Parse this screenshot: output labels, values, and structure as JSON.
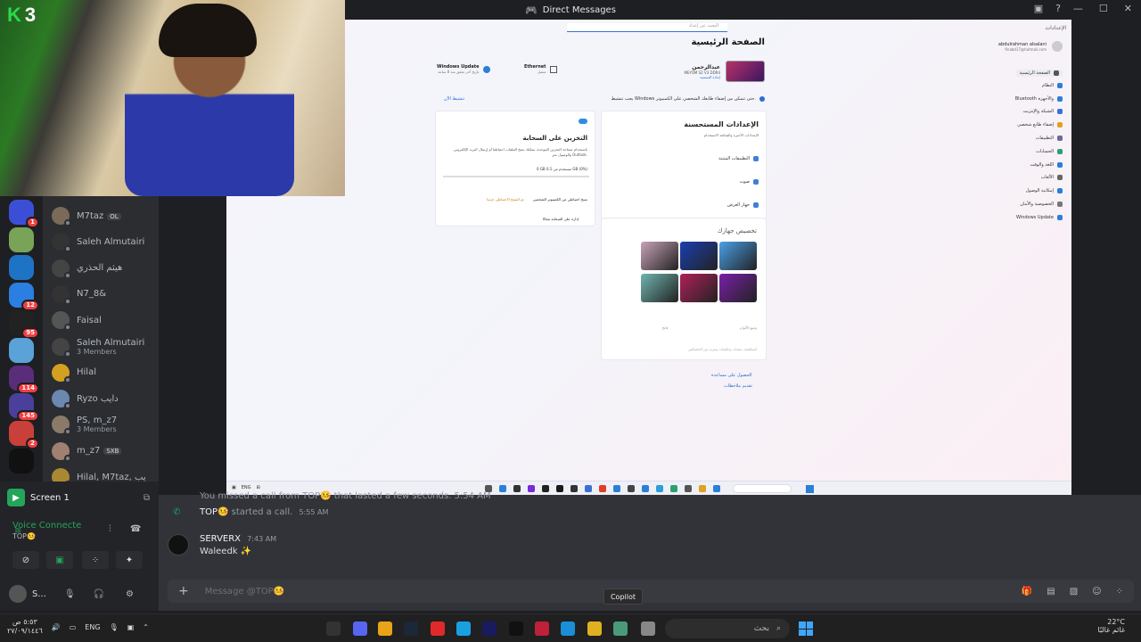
{
  "titlebar": {
    "title": "Direct Messages"
  },
  "webcam": {
    "logo_k": "K",
    "logo_num": "3"
  },
  "servers": [
    {
      "badge": "1",
      "color": "#3b4fd6"
    },
    {
      "badge": "",
      "color": "#7aa35a"
    },
    {
      "badge": "",
      "color": "#1e73c4"
    },
    {
      "badge": "12",
      "color": "#2a7fe0"
    },
    {
      "badge": "95",
      "color": "#222"
    },
    {
      "badge": "",
      "color": "#5aa2d8"
    },
    {
      "badge": "114",
      "color": "#5a2d7a"
    },
    {
      "badge": "145",
      "color": "#4b3f9c"
    },
    {
      "badge": "2",
      "color": "#c9403a"
    },
    {
      "badge": "",
      "color": "#111"
    }
  ],
  "dms": [
    {
      "name": "M7taz",
      "tag": "OL",
      "sub": ""
    },
    {
      "name": "Saleh Almutairi",
      "tag": "",
      "sub": ""
    },
    {
      "name": "هيثم الحذري",
      "tag": "",
      "sub": ""
    },
    {
      "name": "N7_8&",
      "tag": "",
      "sub": ""
    },
    {
      "name": "Faisal",
      "tag": "",
      "sub": ""
    },
    {
      "name": "Saleh Almutairi",
      "tag": "",
      "sub": "3 Members"
    },
    {
      "name": "Hilal",
      "tag": "",
      "sub": ""
    },
    {
      "name": "Ryzo دايب",
      "tag": "",
      "sub": ""
    },
    {
      "name": "PS, m_z7",
      "tag": "",
      "sub": "3 Members"
    },
    {
      "name": "m_z7",
      "tag": "SXB",
      "sub": ""
    },
    {
      "name": "Hilal, M7taz, يب",
      "tag": "",
      "sub": ""
    }
  ],
  "voice": {
    "screen_label": "Screen 1",
    "status": "Voice Connecte",
    "channel": "TOP🤒",
    "user_short": "S..."
  },
  "chat": {
    "partial_top": "You missed a call from TOP🤒 that lasted a few seconds. 5:54 AM",
    "call_started_user": "TOP🤒",
    "call_started_text": "started a call.",
    "call_time": "5:55 AM",
    "msg_author": "SERVERX",
    "msg_time": "7:43 AM",
    "msg_text": "Waleedk ✨",
    "composer_placeholder": "Message @TOP🤒"
  },
  "copilot_tip": "Copilot",
  "share": {
    "breadcrumb": "الإعدادات",
    "search_placeholder": "البحث عن إعداد",
    "page_title": "الصفحة الرئيسية",
    "user_name": "abdulrahman alsalani",
    "user_email": "finabd17@hotmail.com",
    "device_name": "عبدالرحمن",
    "device_spec": "MEYOM S2 V3 DDR4",
    "device_rename": "إعادة التسمية",
    "ethernet": "Ethernet",
    "ethernet_sub": "متصل",
    "winupdate": "Windows Update",
    "winupdate_sub": "تاريخ آخر تحقق منذ 8 ساعة",
    "activate_notice": "يجب تنشيط Windows حتى تتمكن من إضفاء طابعك الشخصي على الكمبيوتر.",
    "activate_link": "تنشيط الآن",
    "recommended_title": "الإعدادات المستحسنة",
    "recommended_sub": "الإعدادات الأخيرة والشائعة الاستخدام",
    "rec_items": [
      "التطبيقات المثبتة",
      "صوت",
      "جهاز العرض"
    ],
    "cloud_title": "التخزين على السحابة",
    "cloud_body": "باستخدام مساحة التخزين الموحدة، يمكنك نسخ الملفات احتياطيا أو إرسال البريد الإلكتروني والوصول عبر Outlook.",
    "cloud_usage": "0 GB مستخدم من 0.1 GB (0%)",
    "cloud_backup": "نسخ احتياطي من الكمبيوتر الشخصي",
    "cloud_backup_status": "تم النسخ الاحتياطي جزئيا",
    "cloud_manage": "إدارة على السحابة مجانًا",
    "personalize_title": "تخصيص جهازك",
    "color_mode": "وضع الألوان",
    "color_mode_val": "فاتح",
    "more_themes": "استكشف سمات وخلفيات ومزيد من الخصائص",
    "help": "الحصول على مساعدة",
    "feedback": "تقديم ملاحظات",
    "sidebar": [
      "الصفحة الرئيسية",
      "النظام",
      "Bluetooth والأجهزة",
      "الشبكة والإنترنت",
      "إضفاء طابع شخصي",
      "التطبيقات",
      "الحسابات",
      "اللغة والوقت",
      "الألعاب",
      "إمكانية الوصول",
      "الخصوصية والأمان",
      "Windows Update"
    ],
    "wallpapers": [
      "#c8a3b8",
      "#1a3fb0",
      "#4aa0e8",
      "#6fb5b0",
      "#b0205a",
      "#7a1fa8"
    ],
    "taskbar_lang": "ENG"
  },
  "taskbar": {
    "time": "٥:٥٣ ص",
    "date": "٢٧/٠٩/١٤٤٦",
    "lang": "ENG",
    "search_label": "بحث",
    "temperature": "22°C",
    "weather": "غائم غالبًا"
  }
}
